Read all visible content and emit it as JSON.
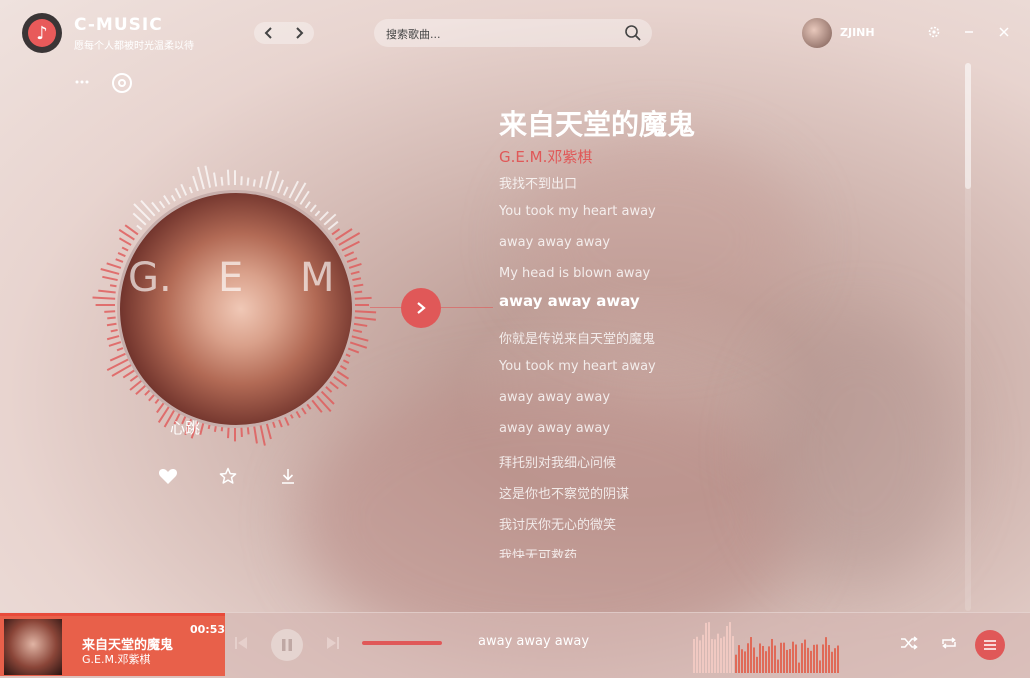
{
  "app": {
    "name": "C-MUSIC",
    "slogan": "愿每个人都被时光温柔以待"
  },
  "nav": {
    "back_icon": "chevron-left-icon",
    "forward_icon": "chevron-right-icon"
  },
  "search": {
    "placeholder": "搜索歌曲..."
  },
  "user": {
    "name": "ZJINH"
  },
  "song": {
    "title": "来自天堂的魔鬼",
    "artist": "G.E.M.邓紫棋",
    "disc_letters": [
      "G.",
      "E",
      "M"
    ],
    "disc_caption": "心跳"
  },
  "lyrics": [
    {
      "text": "我找不到出口",
      "active": false
    },
    {
      "text": "You took my heart away",
      "active": false
    },
    {
      "text": "away away away",
      "active": false
    },
    {
      "text": "My head is blown away",
      "active": false
    },
    {
      "text": "away away away",
      "active": true
    },
    {
      "text": "你就是传说来自天堂的魔鬼",
      "active": false
    },
    {
      "text": "You took my heart away",
      "active": false
    },
    {
      "text": "away away away",
      "active": false
    },
    {
      "text": "away away away",
      "active": false
    },
    {
      "text": "拜托别对我细心问候",
      "active": false
    },
    {
      "text": "这是你也不察觉的阴谋",
      "active": false
    },
    {
      "text": "我讨厌你无心的微笑",
      "active": false
    },
    {
      "text": "我快无可救药",
      "active": false
    }
  ],
  "scroll": {
    "position": 0.0
  },
  "player": {
    "title": "来自天堂的魔鬼",
    "artist": "G.E.M.邓紫棋",
    "time": "00:53",
    "current_lyric": "away away away",
    "progress": 1.0
  },
  "colors": {
    "accent": "#e05858",
    "mini_panel": "#e8604a",
    "progress": "#e84a3a"
  }
}
